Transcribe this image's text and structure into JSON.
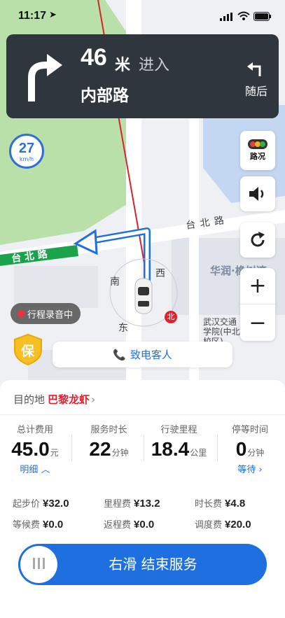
{
  "status": {
    "time": "11:17"
  },
  "nav": {
    "distance": "46",
    "unit": "米",
    "action": "进入",
    "road": "内部路",
    "later": "随后"
  },
  "speed": {
    "value": "27",
    "unit": "km/h"
  },
  "controls": {
    "traffic": "路况"
  },
  "map": {
    "labels": {
      "south": "南",
      "west": "西",
      "east": "东",
      "north": "北",
      "road1": "台 北 路",
      "road2": "台 北 路",
      "area": "华润·橡树湾",
      "school": "武汉交通\n学院(中北\n校区)"
    }
  },
  "recording": {
    "label": "行程录音中"
  },
  "safety": {
    "label": "保"
  },
  "call": {
    "label": "致电客人"
  },
  "trip": {
    "dest_label": "目的地",
    "dest_name": "巴黎龙虾",
    "stats": [
      {
        "title": "总计费用",
        "value": "45.0",
        "unit": "元",
        "link": "明细"
      },
      {
        "title": "服务时长",
        "value": "22",
        "unit": "分钟"
      },
      {
        "title": "行驶里程",
        "value": "18.4",
        "unit": "公里"
      },
      {
        "title": "停等时间",
        "value": "0",
        "unit": "分钟",
        "link": "等待"
      }
    ],
    "fees": [
      {
        "label": "起步价",
        "value": "¥32.0"
      },
      {
        "label": "里程费",
        "value": "¥13.2"
      },
      {
        "label": "时长费",
        "value": "¥4.8"
      },
      {
        "label": "等候费",
        "value": "¥0.0"
      },
      {
        "label": "返程费",
        "value": "¥0.0"
      },
      {
        "label": "调度费",
        "value": "¥20.0"
      }
    ],
    "slider": "右滑  结束服务"
  },
  "colors": {
    "accent": "#1e6fe0",
    "dest": "#e0202d",
    "nav_bg": "#2f363e",
    "green_area": "#b8e0a8"
  }
}
